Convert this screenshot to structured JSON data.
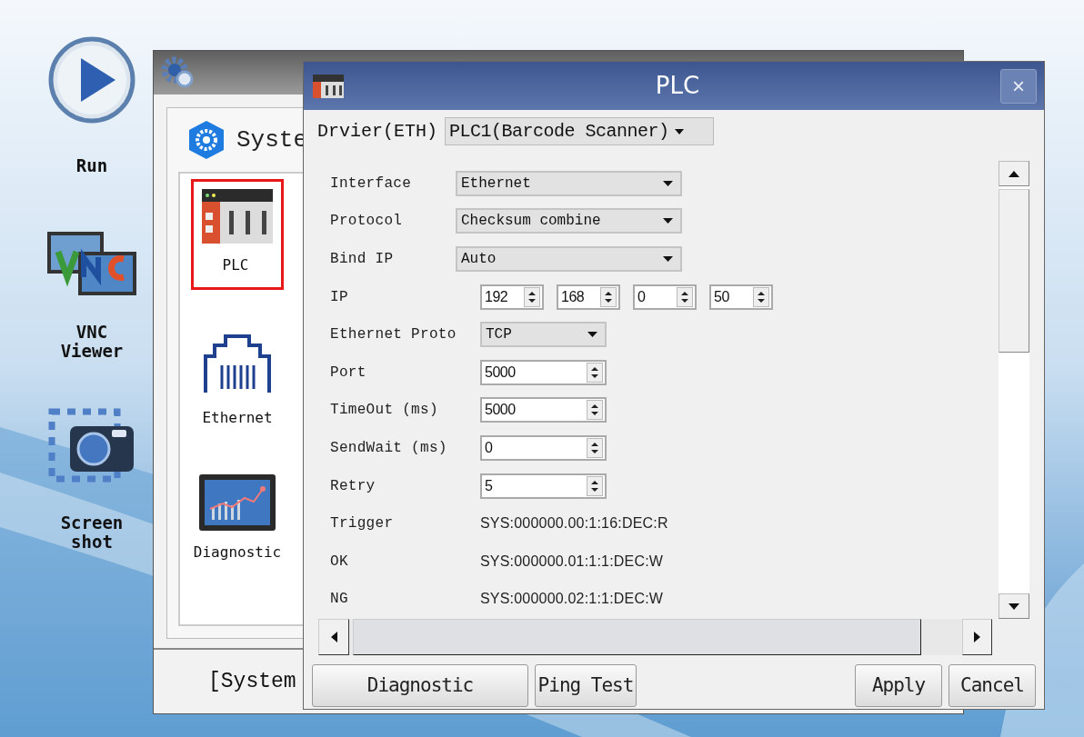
{
  "desktop_icons": [
    {
      "kind": "run",
      "label": "Run"
    },
    {
      "kind": "vnc",
      "label": "VNC Viewer"
    },
    {
      "kind": "screenshot",
      "label": "Screen shot"
    }
  ],
  "system_window": {
    "heading": "Syste",
    "items": [
      {
        "kind": "plc",
        "label": "PLC",
        "selected": true
      },
      {
        "kind": "ethernet",
        "label": "Ethernet",
        "selected": false
      },
      {
        "kind": "diagnostic",
        "label": "Diagnostic",
        "selected": false
      }
    ],
    "footer": "[System"
  },
  "dialog": {
    "title": "PLC",
    "close": "×",
    "driver_label": "Drvier(ETH)",
    "driver_value": "PLC1(Barcode Scanner)",
    "fields": [
      {
        "kind": "dropdown",
        "label": "Interface",
        "value": "Ethernet"
      },
      {
        "kind": "dropdown",
        "label": "Protocol",
        "value": "Checksum combine"
      },
      {
        "kind": "dropdown",
        "label": "Bind IP",
        "value": "Auto"
      },
      {
        "kind": "ip",
        "label": "IP",
        "values": [
          "192",
          "168",
          "0",
          "50"
        ]
      },
      {
        "kind": "small_dropdown",
        "label": "Ethernet Proto",
        "value": "TCP"
      },
      {
        "kind": "spinner",
        "label": "Port",
        "value": "5000"
      },
      {
        "kind": "spinner",
        "label": "TimeOut (ms)",
        "value": "5000"
      },
      {
        "kind": "spinner",
        "label": "SendWait (ms)",
        "value": "0"
      },
      {
        "kind": "spinner",
        "label": "Retry",
        "value": "5"
      },
      {
        "kind": "text",
        "label": "Trigger",
        "value": "SYS:000000.00:1:16:DEC:R"
      },
      {
        "kind": "text",
        "label": "OK",
        "value": "SYS:000000.01:1:1:DEC:W"
      },
      {
        "kind": "text",
        "label": "NG",
        "value": "SYS:000000.02:1:1:DEC:W"
      }
    ],
    "left_buttons": [
      "Diagnostic",
      "Ping Test"
    ],
    "right_buttons": [
      "Apply",
      "Cancel"
    ]
  }
}
